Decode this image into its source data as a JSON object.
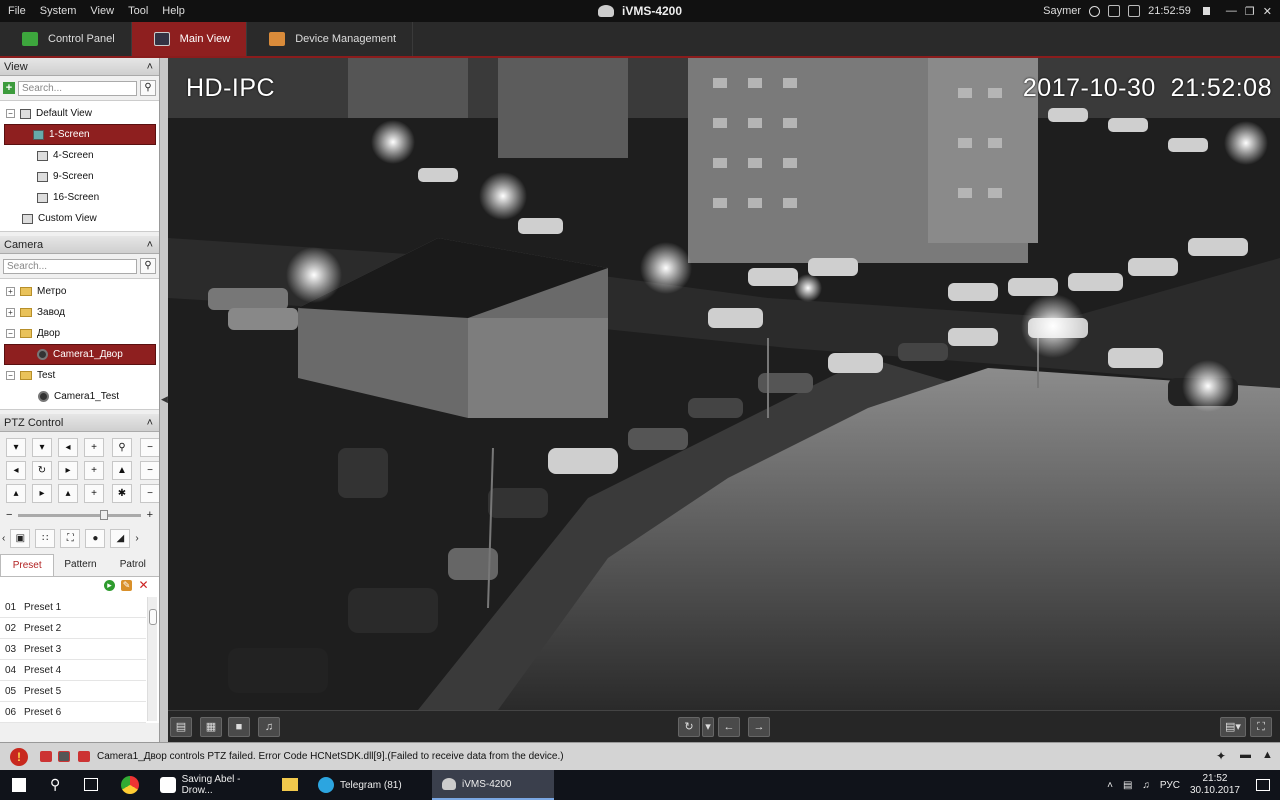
{
  "menubar": {
    "items": [
      "File",
      "System",
      "View",
      "Tool",
      "Help"
    ],
    "app_title": "iVMS-4200",
    "user": "Saymer",
    "time": "21:52:59"
  },
  "tabs": [
    {
      "label": "Control Panel",
      "active": false
    },
    {
      "label": "Main View",
      "active": true
    },
    {
      "label": "Device Management",
      "active": false
    }
  ],
  "view_panel": {
    "title": "View",
    "search_placeholder": "Search...",
    "root": "Default View",
    "items": [
      "1-Screen",
      "4-Screen",
      "9-Screen",
      "16-Screen"
    ],
    "selected": "1-Screen",
    "custom": "Custom View"
  },
  "camera_panel": {
    "title": "Camera",
    "search_placeholder": "Search...",
    "groups": [
      "Метро",
      "Завод",
      "Двор",
      "Test"
    ],
    "dvor_camera": "Camera1_Двор",
    "test_camera": "Camera1_Test"
  },
  "ptz": {
    "title": "PTZ Control",
    "tabs": [
      "Preset",
      "Pattern",
      "Patrol"
    ],
    "active_tab": "Preset",
    "presets": [
      {
        "num": "01",
        "name": "Preset 1"
      },
      {
        "num": "02",
        "name": "Preset 2"
      },
      {
        "num": "03",
        "name": "Preset 3"
      },
      {
        "num": "04",
        "name": "Preset 4"
      },
      {
        "num": "05",
        "name": "Preset 5"
      },
      {
        "num": "06",
        "name": "Preset 6"
      }
    ]
  },
  "video": {
    "osd_name": "HD-IPC",
    "osd_time": "2017-10-30  21:52:08"
  },
  "status": {
    "message": "Camera1_Двор controls PTZ failed. Error Code HCNetSDK.dll[9].(Failed to receive data from the device.)"
  },
  "taskbar": {
    "apps": [
      "Saving Abel - Drow...",
      "Telegram (81)",
      "iVMS-4200"
    ],
    "telegram_badge": "81",
    "lang": "РУС",
    "time": "21:52",
    "date": "30.10.2017"
  },
  "colors": {
    "accent": "#8e1f1f",
    "background": "#1b1b1b"
  }
}
